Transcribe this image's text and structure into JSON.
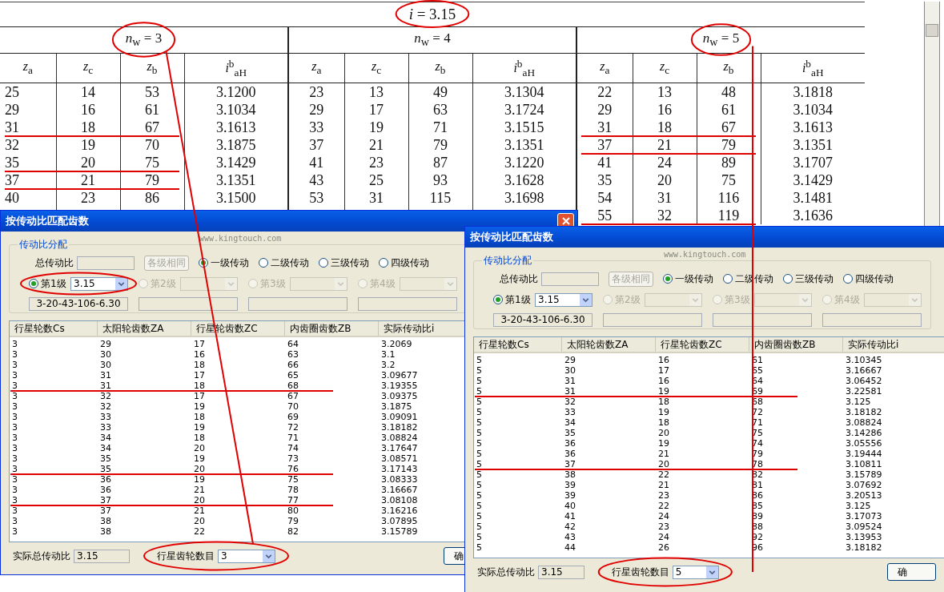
{
  "book_table": {
    "title": "*i* = 3.15",
    "groups": [
      {
        "title": "*n*$_{w}$ = 3",
        "columns": [
          "*z*$_{a}$",
          "*z*$_{c}$",
          "*z*$_{b}$",
          "*i*$^{b}$$_{aH}$"
        ],
        "rows": [
          [
            "25",
            "14",
            "53",
            "3.1200"
          ],
          [
            "29",
            "16",
            "61",
            "3.1034"
          ],
          [
            "31",
            "18",
            "67",
            "3.1613"
          ],
          [
            "32",
            "19",
            "70",
            "3.1875"
          ],
          [
            "35",
            "20",
            "75",
            "3.1429"
          ],
          [
            "37",
            "21",
            "79",
            "3.1351"
          ],
          [
            "40",
            "23",
            "86",
            "3.1500"
          ]
        ]
      },
      {
        "title": "*n*$_{w}$ = 4",
        "columns": [
          "*z*$_{a}$",
          "*z*$_{c}$",
          "*z*$_{b}$",
          "*i*$^{b}$$_{aH}$"
        ],
        "rows": [
          [
            "23",
            "13",
            "49",
            "3.1304"
          ],
          [
            "29",
            "17",
            "63",
            "3.1724"
          ],
          [
            "33",
            "19",
            "71",
            "3.1515"
          ],
          [
            "37",
            "21",
            "79",
            "3.1351"
          ],
          [
            "41",
            "23",
            "87",
            "3.1220"
          ],
          [
            "43",
            "25",
            "93",
            "3.1628"
          ],
          [
            "53",
            "31",
            "115",
            "3.1698"
          ]
        ]
      },
      {
        "title": "*n*$_{w}$ = 5",
        "columns": [
          "*z*$_{a}$",
          "*z*$_{c}$",
          "*z*$_{b}$",
          "*i*$^{b}$$_{aH}$"
        ],
        "rows": [
          [
            "22",
            "13",
            "48",
            "3.1818"
          ],
          [
            "29",
            "16",
            "61",
            "3.1034"
          ],
          [
            "31",
            "18",
            "67",
            "3.1613"
          ],
          [
            "37",
            "21",
            "79",
            "3.1351"
          ],
          [
            "41",
            "24",
            "89",
            "3.1707"
          ],
          [
            "35",
            "20",
            "75",
            "3.1429"
          ],
          [
            "54",
            "31",
            "116",
            "3.1481"
          ],
          [
            "55",
            "32",
            "119",
            "3.1636"
          ]
        ]
      }
    ]
  },
  "dialogs": [
    {
      "title": "按传动比匹配齿数",
      "watermark": "www.kingtouch.com",
      "group_title": "传动比分配",
      "total_label": "总传动比",
      "same_button": "各级相同",
      "stage_options": [
        {
          "label": "一级传动",
          "selected": true
        },
        {
          "label": "二级传动",
          "selected": false
        },
        {
          "label": "三级传动",
          "selected": false
        },
        {
          "label": "四级传动",
          "selected": false
        }
      ],
      "stages": [
        {
          "label": "第1级",
          "selected": true,
          "disabled": false,
          "value": "3.15",
          "result": "3-20-43-106-6.30"
        },
        {
          "label": "第2级",
          "selected": false,
          "disabled": true
        },
        {
          "label": "第3级",
          "selected": false,
          "disabled": true
        },
        {
          "label": "第4级",
          "selected": false,
          "disabled": true
        }
      ],
      "list": {
        "columns": [
          "行星轮数Cs",
          "太阳轮齿数ZA",
          "行星轮齿数ZC",
          "内齿圈齿数ZB",
          "实际传动比i"
        ],
        "rows": [
          [
            "3",
            "29",
            "17",
            "64",
            "3.2069"
          ],
          [
            "3",
            "30",
            "16",
            "63",
            "3.1"
          ],
          [
            "3",
            "30",
            "18",
            "66",
            "3.2"
          ],
          [
            "3",
            "31",
            "17",
            "65",
            "3.09677"
          ],
          [
            "3",
            "31",
            "18",
            "68",
            "3.19355"
          ],
          [
            "3",
            "32",
            "17",
            "67",
            "3.09375"
          ],
          [
            "3",
            "32",
            "19",
            "70",
            "3.1875"
          ],
          [
            "3",
            "33",
            "18",
            "69",
            "3.09091"
          ],
          [
            "3",
            "33",
            "19",
            "72",
            "3.18182"
          ],
          [
            "3",
            "34",
            "18",
            "71",
            "3.08824"
          ],
          [
            "3",
            "34",
            "20",
            "74",
            "3.17647"
          ],
          [
            "3",
            "35",
            "19",
            "73",
            "3.08571"
          ],
          [
            "3",
            "35",
            "20",
            "76",
            "3.17143"
          ],
          [
            "3",
            "36",
            "19",
            "75",
            "3.08333"
          ],
          [
            "3",
            "36",
            "21",
            "78",
            "3.16667"
          ],
          [
            "3",
            "37",
            "20",
            "77",
            "3.08108"
          ],
          [
            "3",
            "37",
            "21",
            "80",
            "3.16216"
          ],
          [
            "3",
            "38",
            "20",
            "79",
            "3.07895"
          ],
          [
            "3",
            "38",
            "22",
            "82",
            "3.15789"
          ]
        ]
      },
      "actual_label": "实际总传动比",
      "actual_value": "3.15",
      "planet_label": "行星齿轮数目",
      "planet_value": "3",
      "ok_button": "确"
    },
    {
      "title": "按传动比匹配齿数",
      "watermark": "www.kingtouch.com",
      "group_title": "传动比分配",
      "total_label": "总传动比",
      "same_button": "各级相同",
      "stage_options": [
        {
          "label": "一级传动",
          "selected": true
        },
        {
          "label": "二级传动",
          "selected": false
        },
        {
          "label": "三级传动",
          "selected": false
        },
        {
          "label": "四级传动",
          "selected": false
        }
      ],
      "stages": [
        {
          "label": "第1级",
          "selected": true,
          "disabled": false,
          "value": "3.15",
          "result": "3-20-43-106-6.30"
        },
        {
          "label": "第2级",
          "selected": false,
          "disabled": true
        },
        {
          "label": "第3级",
          "selected": false,
          "disabled": true
        },
        {
          "label": "第4级",
          "selected": false,
          "disabled": true
        }
      ],
      "list": {
        "columns": [
          "行星轮数Cs",
          "太阳轮齿数ZA",
          "行星轮齿数ZC",
          "内齿圈齿数ZB",
          "实际传动比i"
        ],
        "rows": [
          [
            "5",
            "29",
            "16",
            "61",
            "3.10345"
          ],
          [
            "5",
            "30",
            "17",
            "65",
            "3.16667"
          ],
          [
            "5",
            "31",
            "16",
            "64",
            "3.06452"
          ],
          [
            "5",
            "31",
            "19",
            "69",
            "3.22581"
          ],
          [
            "5",
            "32",
            "18",
            "68",
            "3.125"
          ],
          [
            "5",
            "33",
            "19",
            "72",
            "3.18182"
          ],
          [
            "5",
            "34",
            "18",
            "71",
            "3.08824"
          ],
          [
            "5",
            "35",
            "20",
            "75",
            "3.14286"
          ],
          [
            "5",
            "36",
            "19",
            "74",
            "3.05556"
          ],
          [
            "5",
            "36",
            "21",
            "79",
            "3.19444"
          ],
          [
            "5",
            "37",
            "20",
            "78",
            "3.10811"
          ],
          [
            "5",
            "38",
            "22",
            "82",
            "3.15789"
          ],
          [
            "5",
            "39",
            "21",
            "81",
            "3.07692"
          ],
          [
            "5",
            "39",
            "23",
            "86",
            "3.20513"
          ],
          [
            "5",
            "40",
            "22",
            "85",
            "3.125"
          ],
          [
            "5",
            "41",
            "24",
            "89",
            "3.17073"
          ],
          [
            "5",
            "42",
            "23",
            "88",
            "3.09524"
          ],
          [
            "5",
            "43",
            "24",
            "92",
            "3.13953"
          ],
          [
            "5",
            "44",
            "26",
            "96",
            "3.18182"
          ]
        ]
      },
      "actual_label": "实际总传动比",
      "actual_value": "3.15",
      "planet_label": "行星齿轮数目",
      "planet_value": "5",
      "ok_button": "确"
    }
  ]
}
